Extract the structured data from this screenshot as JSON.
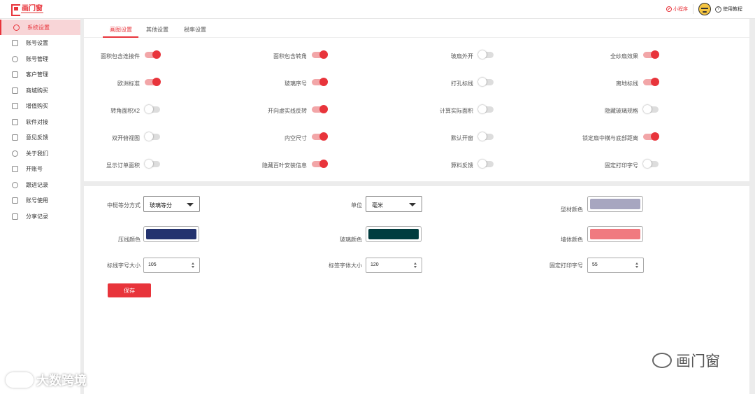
{
  "header": {
    "logo_text": "画门窗",
    "mini_program": "小程序",
    "help": "使用教程"
  },
  "sidebar": {
    "items": [
      {
        "label": "系统设置",
        "active": true
      },
      {
        "label": "账号设置"
      },
      {
        "label": "账号管理"
      },
      {
        "label": "客户管理"
      },
      {
        "label": "商城购买"
      },
      {
        "label": "增值购买"
      },
      {
        "label": "软件对接"
      },
      {
        "label": "意见反馈"
      },
      {
        "label": "关于我们"
      },
      {
        "label": "开账号"
      },
      {
        "label": "跟进记录"
      },
      {
        "label": "账号使用"
      },
      {
        "label": "分享记录"
      }
    ]
  },
  "tabs": [
    "画图设置",
    "其他设置",
    "税率设置"
  ],
  "toggles": [
    [
      {
        "label": "面积包含连接件",
        "on": true
      },
      {
        "label": "面积包含转角",
        "on": true
      },
      {
        "label": "玻扇外开",
        "on": false
      },
      {
        "label": "全纱扇效果",
        "on": true
      }
    ],
    [
      {
        "label": "欧洲标准",
        "on": true
      },
      {
        "label": "玻璃序号",
        "on": true
      },
      {
        "label": "打孔标线",
        "on": false
      },
      {
        "label": "离地标线",
        "on": true
      }
    ],
    [
      {
        "label": "转角面积X2",
        "on": false
      },
      {
        "label": "开向虚实线反转",
        "on": true
      },
      {
        "label": "计算实际面积",
        "on": false
      },
      {
        "label": "隐藏玻璃规格",
        "on": false
      }
    ],
    [
      {
        "label": "双开俯视图",
        "on": false
      },
      {
        "label": "内空尺寸",
        "on": true
      },
      {
        "label": "默认开窗",
        "on": false
      },
      {
        "label": "锁定扇中横与底部距离",
        "on": true
      }
    ],
    [
      {
        "label": "显示订单面积",
        "on": false
      },
      {
        "label": "隐藏百叶安装信息",
        "on": true
      },
      {
        "label": "算料反馈",
        "on": false
      },
      {
        "label": "固定打印字号",
        "on": false
      }
    ]
  ],
  "form": {
    "mullion_label": "中梃等分方式",
    "mullion_value": "玻璃等分",
    "unit_label": "单位",
    "unit_value": "毫米",
    "profile_color_label": "型材颜色",
    "profile_color": "#a7a6c0",
    "bead_color_label": "压线颜色",
    "bead_color": "#24336f",
    "glass_color_label": "玻璃颜色",
    "glass_color": "#013d3f",
    "wall_color_label": "墙体颜色",
    "wall_color": "#f07a80",
    "mark_font_label": "标线字号大小",
    "mark_font_value": "105",
    "tag_font_label": "标签字体大小",
    "tag_font_value": "120",
    "print_font_label": "固定打印字号",
    "print_font_value": "55",
    "save_label": "保存"
  },
  "watermarks": {
    "left": "大数跨境",
    "right": "画门窗"
  }
}
